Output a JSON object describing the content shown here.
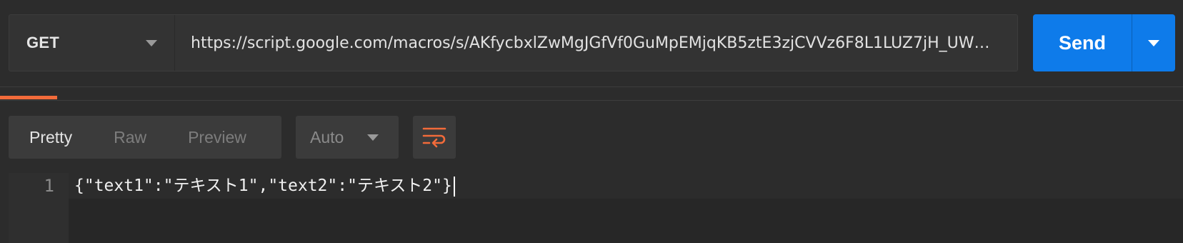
{
  "request": {
    "method": "GET",
    "url": "https://script.google.com/macros/s/AKfycbxlZwMgJGfVf0GuMpEMjqKB5ztE3zjCVVz6F8L1LUZ7jH_UW…"
  },
  "send": {
    "label": "Send",
    "color": "#0e7bea"
  },
  "tabs": {
    "active_indicator_color": "#f26b3a"
  },
  "response": {
    "view_tabs": [
      {
        "label": "Pretty",
        "active": true
      },
      {
        "label": "Raw",
        "active": false
      },
      {
        "label": "Preview",
        "active": false
      }
    ],
    "format": "Auto",
    "wrap_icon": "wrap-lines-icon",
    "wrap_icon_color": "#f26b3a",
    "body": {
      "line_numbers": [
        "1"
      ],
      "lines": [
        "{\"text1\":\"テキスト1\",\"text2\":\"テキスト2\"}"
      ]
    }
  }
}
